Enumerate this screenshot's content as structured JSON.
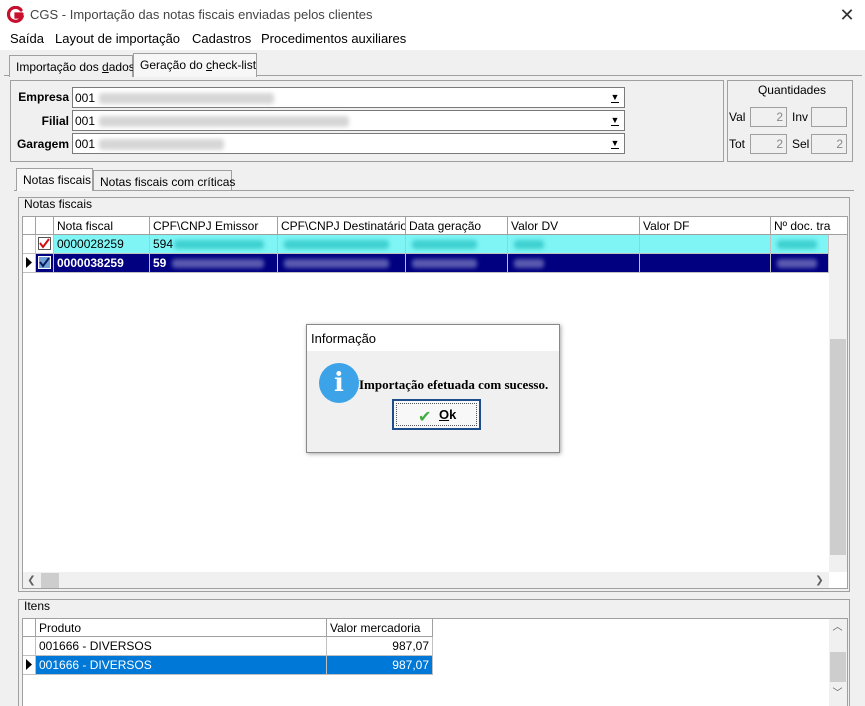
{
  "window": {
    "title": "CGS - Importação das notas fiscais enviadas pelos clientes",
    "logo": "G",
    "close_glyph": "✕"
  },
  "menu": [
    "Saída",
    "Layout de importação",
    "Cadastros",
    "Procedimentos auxiliares"
  ],
  "top_tabs": {
    "import_prefix": "Importação dos ",
    "import_underlined": "d",
    "import_suffix": "ados",
    "checklist_prefix": "Geração do ",
    "checklist_underlined": "c",
    "checklist_suffix": "heck-list"
  },
  "header": {
    "empresa_label": "Empresa",
    "empresa_code": "001",
    "filial_label": "Filial",
    "filial_code": "001",
    "garagem_label": "Garagem",
    "garagem_code": "001"
  },
  "quantidades": {
    "title": "Quantidades",
    "val_label": "Val",
    "val_value": "2",
    "inv_label": "Inv",
    "inv_value": "",
    "tot_label": "Tot",
    "tot_value": "2",
    "sel_label": "Sel",
    "sel_value": "2"
  },
  "inner_tabs": [
    "Notas fiscais",
    "Notas fiscais com críticas"
  ],
  "notas_group": {
    "title": "Notas fiscais",
    "columns": [
      "Nota fiscal",
      "CPF\\CNPJ Emissor",
      "CPF\\CNPJ Destinatário",
      "Data geração",
      "Valor DV",
      "Valor DF",
      "Nº doc. tra"
    ],
    "rows": [
      {
        "nota": "0000028259",
        "cpf_prefix": "594"
      },
      {
        "nota": "0000038259",
        "cpf_prefix": "59"
      }
    ]
  },
  "itens_group": {
    "title": "Itens",
    "columns": [
      "Produto",
      "Valor mercadoria"
    ],
    "rows": [
      {
        "produto": "001666 - DIVERSOS",
        "valor": "987,07"
      },
      {
        "produto": "001666 - DIVERSOS",
        "valor": "987,07"
      }
    ]
  },
  "dialog": {
    "title": "Informação",
    "icon": "i",
    "message": "Importação efetuada com sucesso.",
    "ok_check": "✔",
    "ok_underlined": "O",
    "ok_rest": "k"
  },
  "colors": {
    "row_cyan": "#7ff5f5",
    "row_navy": "#000080",
    "itens_selected": "#0078d7",
    "info_blue": "#3da3e8",
    "logo_red": "#c8102e"
  }
}
